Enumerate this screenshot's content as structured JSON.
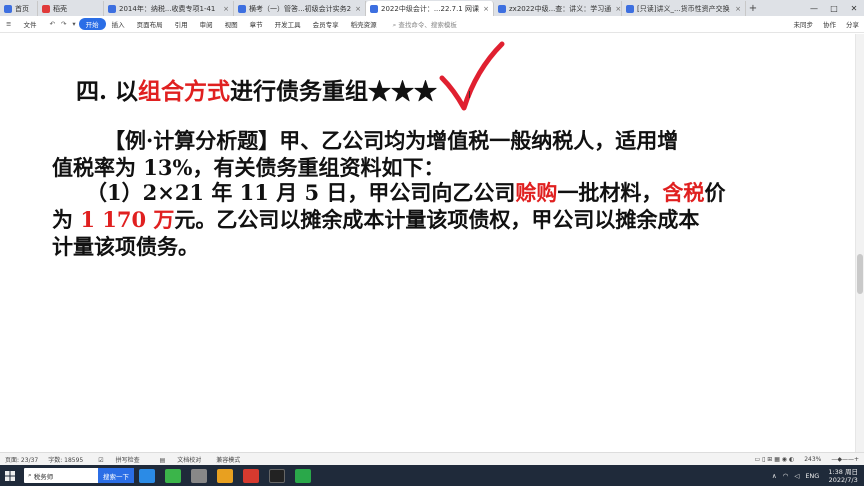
{
  "browser_tabs": [
    {
      "label": "首页",
      "color": "#3d6fe0",
      "active": false
    },
    {
      "label": "稻壳",
      "color": "#e03a3a",
      "active": false
    },
    {
      "label": "2014年：纳税...收费专项1-41",
      "color": "#3d6fe0",
      "active": false
    },
    {
      "label": "横考（一）管答...初级会计实务2",
      "color": "#3d6fe0",
      "active": false
    },
    {
      "label": "2022中级会计：...22.7.1 网课",
      "color": "#3d6fe0",
      "active": true
    },
    {
      "label": "zx2022中级...查：讲义：学习通",
      "color": "#3d6fe0",
      "active": false
    },
    {
      "label": "[只读]讲义_...货币性资产交换",
      "color": "#3d6fe0",
      "active": false
    }
  ],
  "window_controls": [
    "—",
    "□",
    "✕"
  ],
  "ribbon": {
    "file": "文件",
    "quick_access": [
      "↶",
      "↷",
      "▾"
    ],
    "tabs": [
      "开始",
      "插入",
      "页面布局",
      "引用",
      "审阅",
      "视图",
      "章节",
      "开发工具",
      "会员专享",
      "稻壳资源"
    ],
    "search": "查找命令、搜索模板",
    "right": [
      "未同步",
      "协作",
      "分享"
    ]
  },
  "document": {
    "heading_prefix": "四. 以",
    "heading_red": "组合方式",
    "heading_suffix": "进行债务重组★★★",
    "para1_line1": "【例·计算分析题】甲、乙公司均为增值税一般纳税人，适用增",
    "para1_line2": "值税率为 13%，有关债务重组资料如下：",
    "para2_a": "（1）2×21 年 11 月 5 日，甲公司向乙公司",
    "para2_red1": "赊购",
    "para2_b": "一批材料，",
    "para2_red2": "含税",
    "para2_c": "价",
    "para3_a": "为 ",
    "para3_red": "1 170 万",
    "para3_b": "元。乙公司以摊余成本计量该项债权，甲公司以摊余成本",
    "para4": "计量该项债务。"
  },
  "status": {
    "page": "页面: 23/37",
    "words": "字数: 18595",
    "spell": "拼写检查",
    "proof": "文档校对",
    "compat": "兼容模式",
    "zoom": "243%"
  },
  "taskbar": {
    "search_text": "税务师",
    "search_button": "搜索一下",
    "tray": [
      "∧",
      "ENG"
    ],
    "time": "1:38 周日",
    "date": "2022/7/3"
  }
}
